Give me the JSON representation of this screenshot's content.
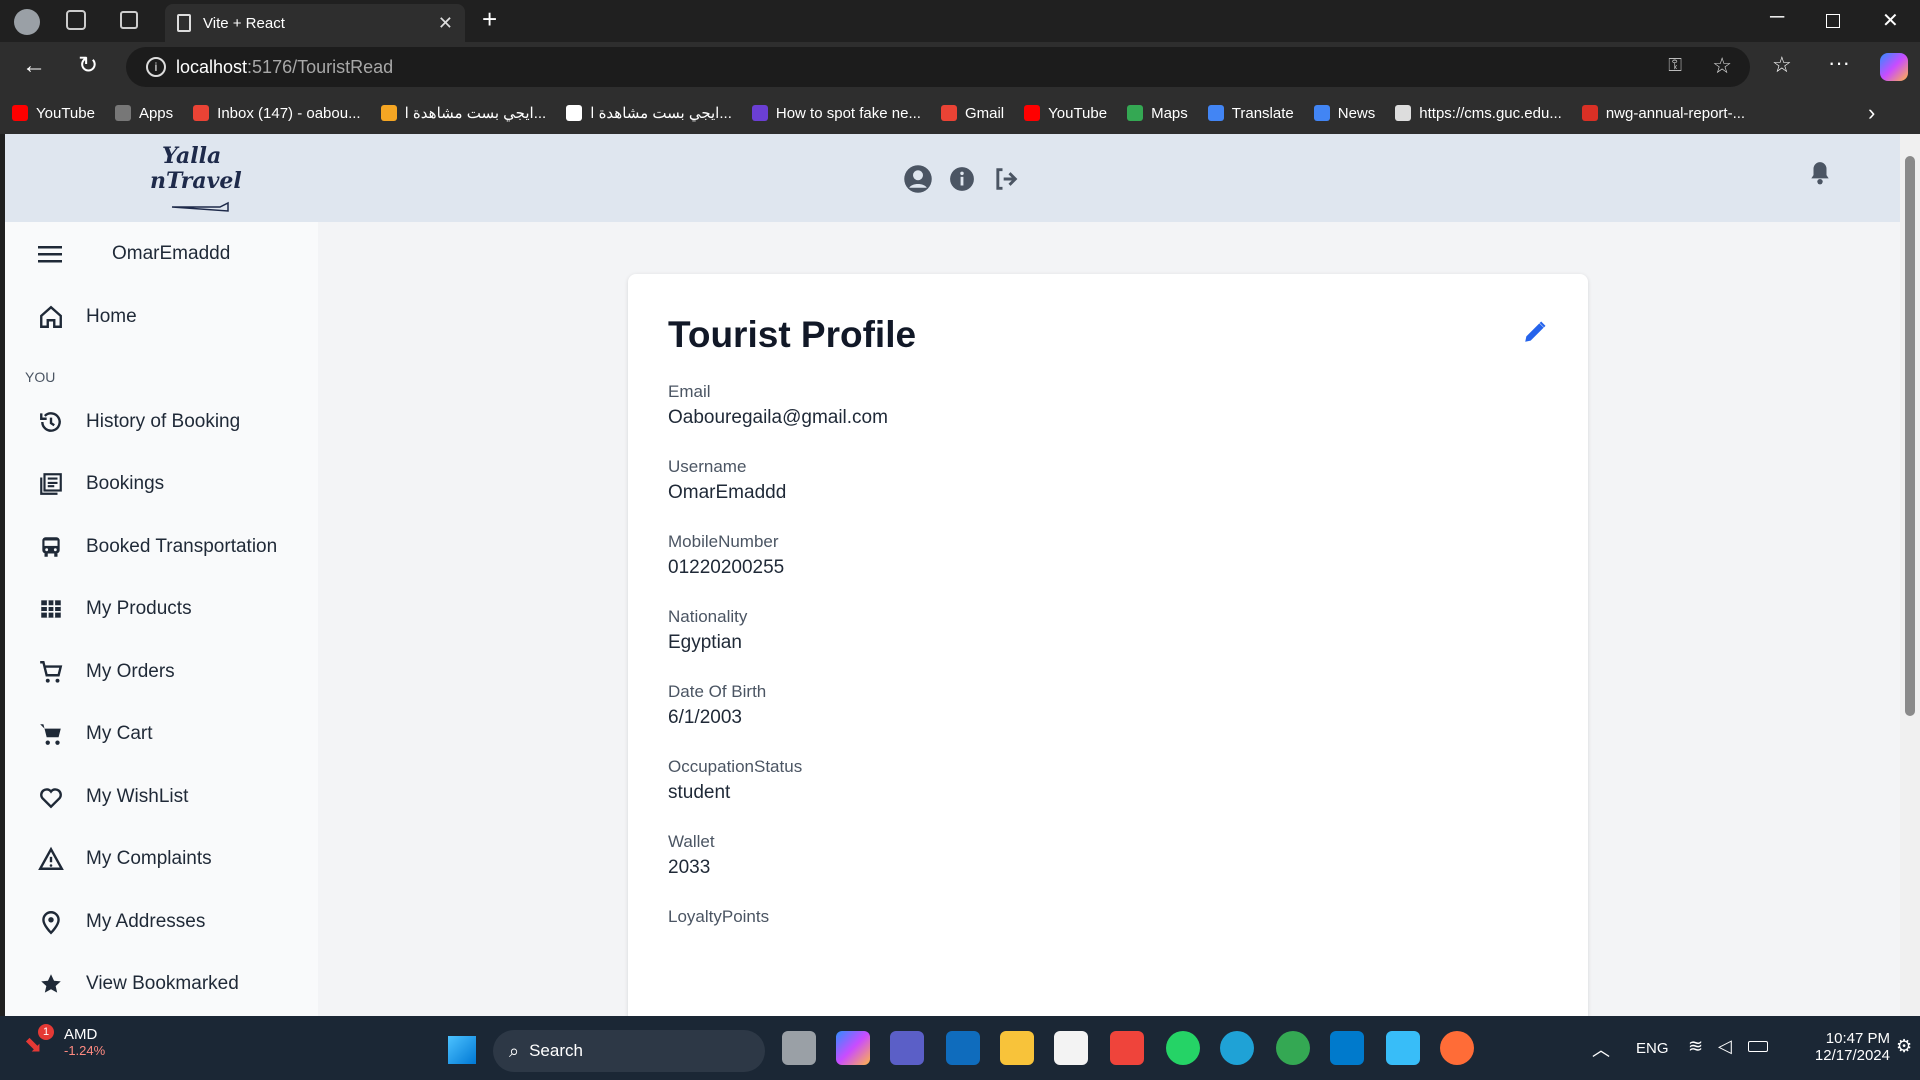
{
  "browser": {
    "tab_title": "Vite + React",
    "url_host": "localhost",
    "url_path": ":5176/TouristRead"
  },
  "bookmarks": [
    {
      "label": "YouTube",
      "color": "#ff0000"
    },
    {
      "label": "Apps",
      "color": "#777777"
    },
    {
      "label": "Inbox (147) - oabou...",
      "color": "#ea4335"
    },
    {
      "label": "ايجي بست مشاهدة ا...",
      "color": "#f5a623"
    },
    {
      "label": "ايجي بست مشاهدة ا...",
      "color": "#ffffff"
    },
    {
      "label": "How to spot fake ne...",
      "color": "#6b3fd4"
    },
    {
      "label": "Gmail",
      "color": "#ea4335"
    },
    {
      "label": "YouTube",
      "color": "#ff0000"
    },
    {
      "label": "Maps",
      "color": "#34a853"
    },
    {
      "label": "Translate",
      "color": "#4285f4"
    },
    {
      "label": "News",
      "color": "#4285f4"
    },
    {
      "label": "https://cms.guc.edu...",
      "color": "#dddddd"
    },
    {
      "label": "nwg-annual-report-...",
      "color": "#d93025"
    }
  ],
  "app": {
    "logo_line1": "Yalla",
    "logo_line2": "nTravel",
    "username": "OmarEmaddd",
    "sidebar": {
      "home": "Home",
      "section": "YOU",
      "items": [
        {
          "label": "History of Booking",
          "icon": "history-icon"
        },
        {
          "label": "Bookings",
          "icon": "bookings-icon"
        },
        {
          "label": "Booked Transportation",
          "icon": "bus-icon"
        },
        {
          "label": "My Products",
          "icon": "grid-icon"
        },
        {
          "label": "My Orders",
          "icon": "cart-outline-icon"
        },
        {
          "label": "My Cart",
          "icon": "cart-icon"
        },
        {
          "label": "My WishList",
          "icon": "heart-icon"
        },
        {
          "label": "My Complaints",
          "icon": "warning-icon"
        },
        {
          "label": "My Addresses",
          "icon": "location-icon"
        },
        {
          "label": "View Bookmarked",
          "icon": "star-icon"
        }
      ]
    },
    "profile": {
      "title": "Tourist Profile",
      "fields": [
        {
          "label": "Email",
          "value": "Oabouregaila@gmail.com"
        },
        {
          "label": "Username",
          "value": "OmarEmaddd"
        },
        {
          "label": "MobileNumber",
          "value": "01220200255"
        },
        {
          "label": "Nationality",
          "value": "Egyptian"
        },
        {
          "label": "Date Of Birth",
          "value": "6/1/2003"
        },
        {
          "label": "OccupationStatus",
          "value": "student"
        },
        {
          "label": "Wallet",
          "value": "2033"
        },
        {
          "label": "LoyaltyPoints",
          "value": ""
        }
      ]
    }
  },
  "taskbar": {
    "stock_name": "AMD",
    "stock_change": "-1.24%",
    "stock_badge": "1",
    "search_label": "Search",
    "lang": "ENG",
    "time": "10:47 PM",
    "date": "12/17/2024"
  }
}
